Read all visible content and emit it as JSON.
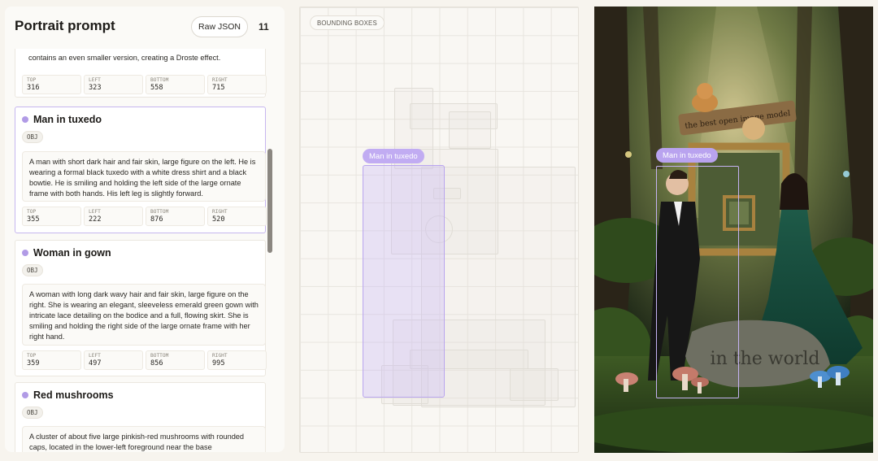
{
  "header": {
    "title": "Portrait prompt",
    "raw_json_label": "Raw JSON",
    "count": "11"
  },
  "objects": [
    {
      "title": "",
      "tag": "",
      "description": "contains an even smaller version, creating a Droste effect.",
      "bbox_labels": {
        "top": "TOP",
        "left": "LEFT",
        "bottom": "BOTTOM",
        "right": "RIGHT"
      },
      "bbox": {
        "top": "316",
        "left": "323",
        "bottom": "558",
        "right": "715"
      }
    },
    {
      "title": "Man in tuxedo",
      "tag": "OBJ",
      "description": "A man with short dark hair and fair skin, large figure on the left. He is wearing a formal black tuxedo with a white dress shirt and a black bowtie. He is smiling and holding the left side of the large ornate frame with both hands. His left leg is slightly forward.",
      "bbox": {
        "top": "355",
        "left": "222",
        "bottom": "876",
        "right": "520"
      }
    },
    {
      "title": "Woman in gown",
      "tag": "OBJ",
      "description": "A woman with long dark wavy hair and fair skin, large figure on the right. She is wearing an elegant, sleeveless emerald green gown with intricate lace detailing on the bodice and a full, flowing skirt. She is smiling and holding the right side of the large ornate frame with her right hand.",
      "bbox": {
        "top": "359",
        "left": "497",
        "bottom": "856",
        "right": "995"
      }
    },
    {
      "title": "Red mushrooms",
      "tag": "OBJ",
      "description": "A cluster of about five large pinkish-red mushrooms with rounded caps, located in the lower-left foreground near the base"
    }
  ],
  "bbox_panel": {
    "tag": "BOUNDING BOXES",
    "selected_label": "Man in tuxedo"
  },
  "image": {
    "sign_text": "the best open image model",
    "stone_text": "in the world",
    "selected_label": "Man in tuxedo"
  },
  "colors": {
    "accent": "#b9a5ee",
    "accent_fill": "#c8b8f5",
    "dot": "#b19be6",
    "background": "#f7f4ee"
  },
  "icons": {
    "object_dot": "purple-dot-icon"
  }
}
